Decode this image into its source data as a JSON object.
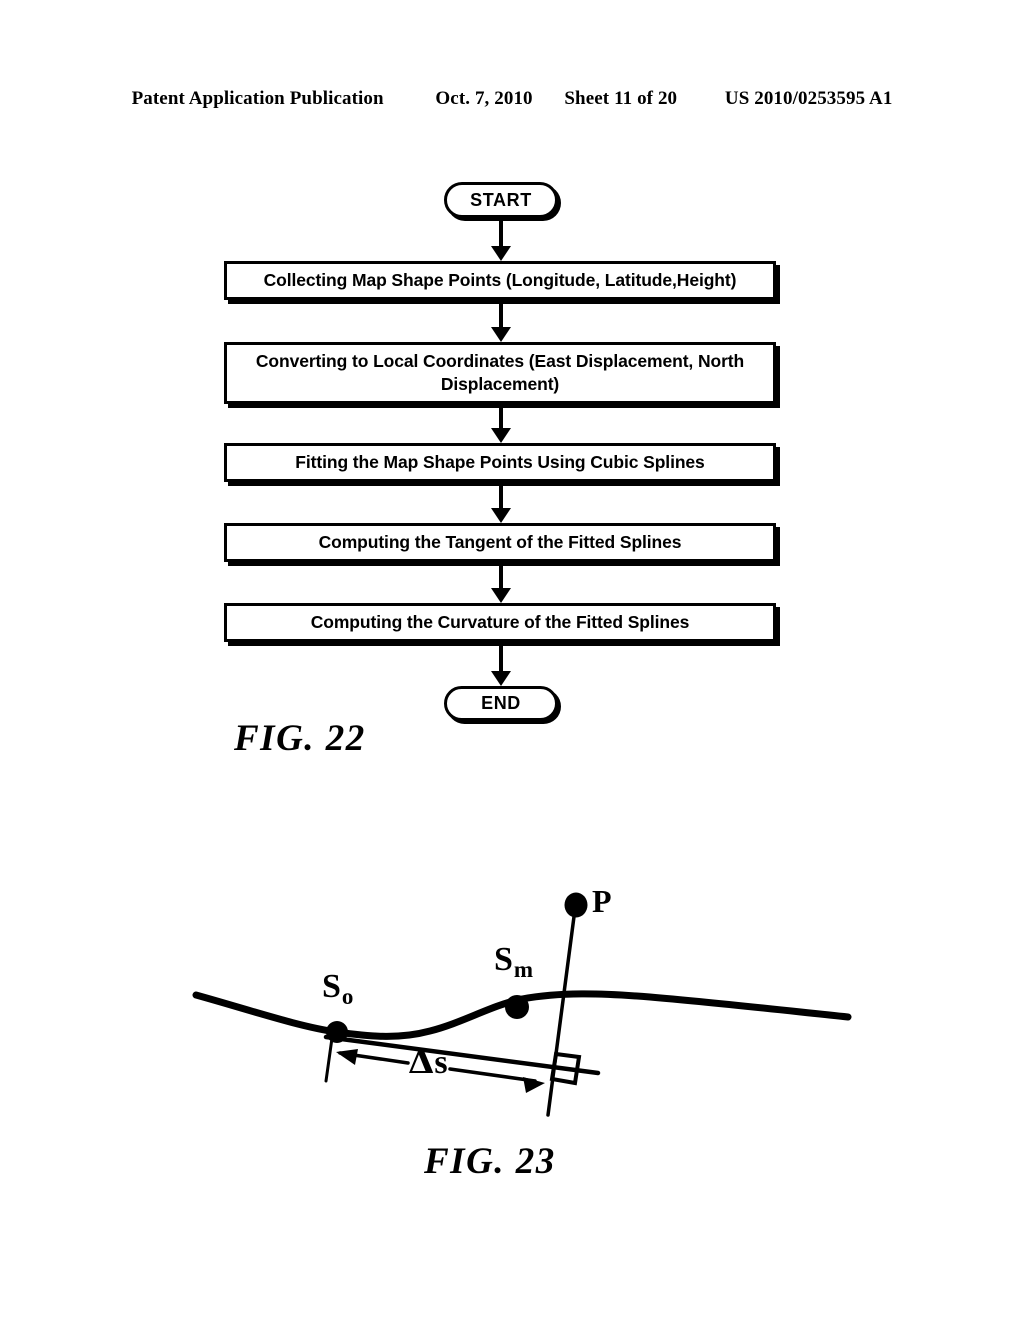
{
  "header": {
    "publication": "Patent Application Publication",
    "date": "Oct. 7, 2010",
    "sheet": "Sheet 11 of 20",
    "patent_number": "US 2010/0253595 A1"
  },
  "figure22": {
    "caption": "FIG. 22",
    "start_label": "START",
    "end_label": "END",
    "steps": [
      {
        "text": "Collecting Map Shape Points (Longitude, Latitude,Height)"
      },
      {
        "text": "Converting to Local Coordinates (East Displacement, North Displacement)"
      },
      {
        "text": "Fitting the Map Shape Points Using Cubic Splines"
      },
      {
        "text": "Computing the Tangent of the Fitted Splines"
      },
      {
        "text": "Computing the Curvature of the Fitted Splines"
      }
    ]
  },
  "figure23": {
    "caption": "FIG. 23",
    "labels": {
      "s0_base": "S",
      "s0_sub": "o",
      "sm_base": "S",
      "sm_sub": "m",
      "point_p": "P",
      "delta_s_symbol": "Δ",
      "delta_s_var": "s"
    }
  },
  "colors": {
    "ink": "#000000",
    "paper": "#ffffff"
  }
}
